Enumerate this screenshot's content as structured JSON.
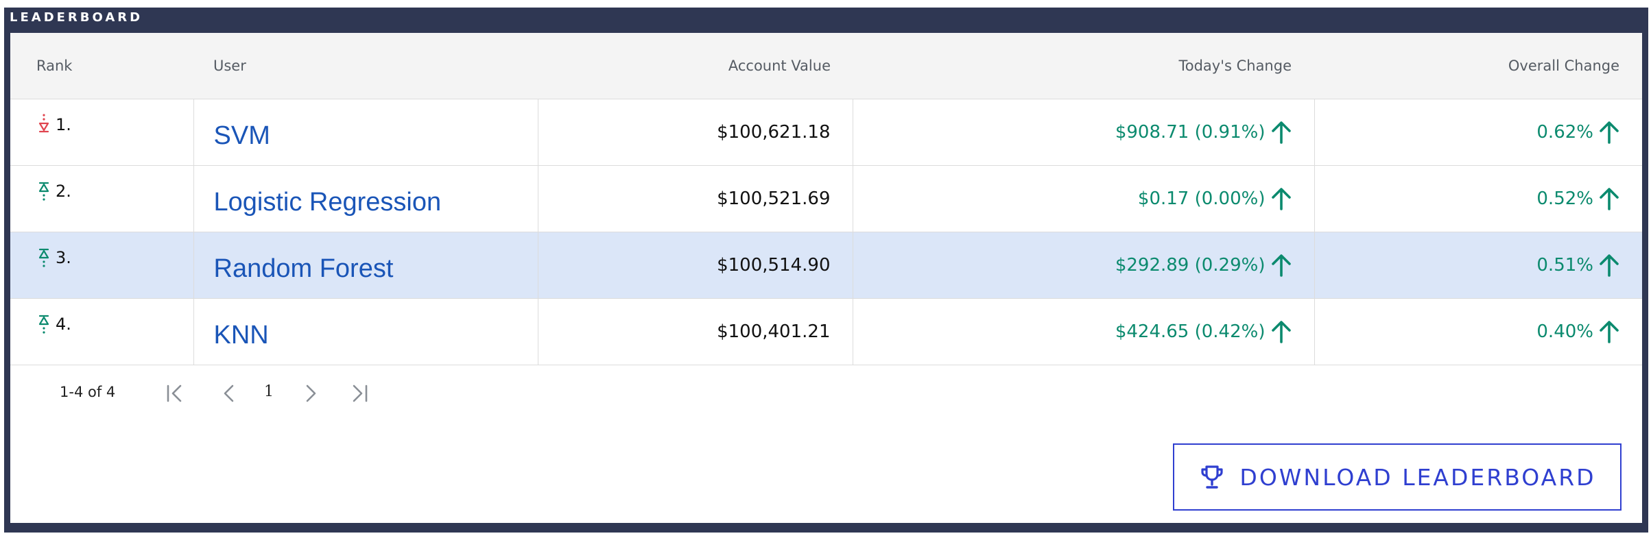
{
  "frame": {
    "title": "LEADERBOARD"
  },
  "columns": {
    "rank": "Rank",
    "user": "User",
    "account_value": "Account Value",
    "todays_change": "Today's Change",
    "overall_change": "Overall Change"
  },
  "rows": [
    {
      "trend": "down",
      "rank": "1.",
      "user": "SVM",
      "account_value": "$100,621.18",
      "todays_change": "$908.71 (0.91%)",
      "overall_change": "0.62%",
      "highlighted": false
    },
    {
      "trend": "up",
      "rank": "2.",
      "user": "Logistic Regression",
      "account_value": "$100,521.69",
      "todays_change": "$0.17 (0.00%)",
      "overall_change": "0.52%",
      "highlighted": false
    },
    {
      "trend": "up",
      "rank": "3.",
      "user": "Random Forest",
      "account_value": "$100,514.90",
      "todays_change": "$292.89 (0.29%)",
      "overall_change": "0.51%",
      "highlighted": true
    },
    {
      "trend": "up",
      "rank": "4.",
      "user": "KNN",
      "account_value": "$100,401.21",
      "todays_change": "$424.65 (0.42%)",
      "overall_change": "0.40%",
      "highlighted": false
    }
  ],
  "pagination": {
    "range_text": "1-4 of 4",
    "current_page": "1"
  },
  "download": {
    "label": "DOWNLOAD LEADERBOARD",
    "icon": "trophy-icon"
  },
  "colors": {
    "frame": "#2f3753",
    "positive": "#0b8a6e",
    "negative": "#e0454f",
    "link": "#1a55b7",
    "accent": "#2f3fd0",
    "highlight_row": "#dbe6f8"
  }
}
